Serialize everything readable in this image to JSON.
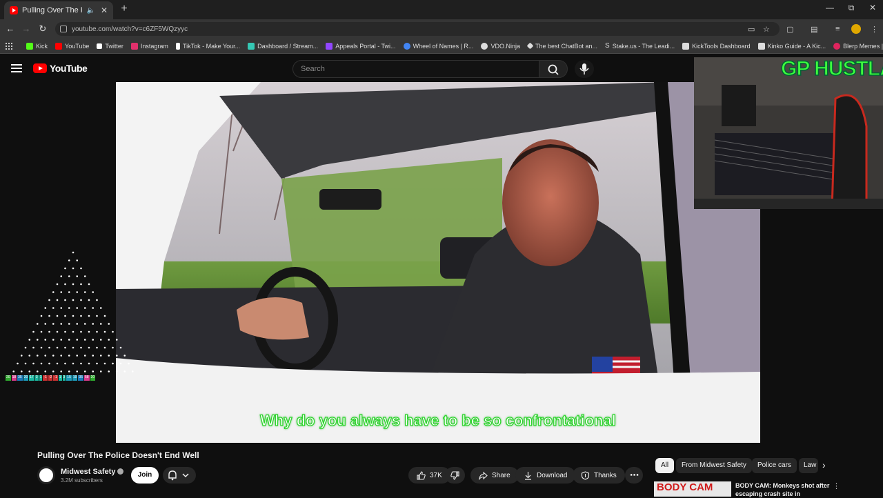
{
  "browser": {
    "tab_title": "Pulling Over The Police Doe",
    "new_tab": "+",
    "url": "youtube.com/watch?v=c6ZF5WQzyyc",
    "bookmarks": [
      {
        "label": "Kick",
        "icon": "kick-icon",
        "color": "#53fc18"
      },
      {
        "label": "YouTube",
        "icon": "youtube-icon",
        "color": "#ff0000"
      },
      {
        "label": "Twitter",
        "icon": "twitter-icon",
        "color": "#ffffff"
      },
      {
        "label": "Instagram",
        "icon": "instagram-icon",
        "color": "#e1306c"
      },
      {
        "label": "TikTok - Make Your...",
        "icon": "tiktok-icon",
        "color": "#ffffff"
      },
      {
        "label": "Dashboard / Stream...",
        "icon": "streamelements-icon",
        "color": "#35c8b4"
      },
      {
        "label": "Appeals Portal - Twi...",
        "icon": "twitch-icon",
        "color": "#9146ff"
      },
      {
        "label": "Wheel of Names | R...",
        "icon": "wheel-icon",
        "color": "#4285f4"
      },
      {
        "label": "VDO.Ninja",
        "icon": "vdo-ninja-icon",
        "color": "#dddddd"
      },
      {
        "label": "The best ChatBot an...",
        "icon": "chatbot-icon",
        "color": "#dddddd"
      },
      {
        "label": "Stake.us - The Leadi...",
        "icon": "stake-icon",
        "color": "#dddddd"
      },
      {
        "label": "KickTools Dashboard",
        "icon": "kicktools-icon",
        "color": "#dddddd"
      },
      {
        "label": "Kinko Guide - A Kic...",
        "icon": "kinko-icon",
        "color": "#dddddd"
      },
      {
        "label": "Blerp Memes | Best...",
        "icon": "blerp-icon",
        "color": "#e0245e"
      }
    ]
  },
  "youtube": {
    "logo_text": "YouTube",
    "search_placeholder": "Search"
  },
  "video": {
    "subtitle": "Why do you always have to be so confrontational",
    "webcam_tag": "GP HUSTLA"
  },
  "overlay_stats": [
    {
      "text": "20",
      "color": "#2ea82e"
    },
    {
      "text": "18",
      "color": "#d63b8a"
    },
    {
      "text": "35",
      "color": "#1c7ab8"
    },
    {
      "text": "20",
      "color": "#1c9ab8"
    },
    {
      "text": "17",
      "color": "#1cb8a0"
    },
    {
      "text": "3",
      "color": "#1cb8a0"
    },
    {
      "text": "1",
      "color": "#1cb8a0"
    },
    {
      "text": "-1",
      "color": "#c93232"
    },
    {
      "text": "-2",
      "color": "#c93232"
    },
    {
      "text": "-1",
      "color": "#c93232"
    },
    {
      "text": "1",
      "color": "#1cb8a0"
    },
    {
      "text": "3",
      "color": "#1cb8a0"
    },
    {
      "text": "15",
      "color": "#1c9ab8"
    },
    {
      "text": "19",
      "color": "#1c9ab8"
    },
    {
      "text": "35",
      "color": "#1c7ab8"
    },
    {
      "text": "58",
      "color": "#d63b8a"
    },
    {
      "text": "20",
      "color": "#2ea82e"
    }
  ],
  "watch": {
    "title": "Pulling Over The Police Doesn't End Well",
    "channel": "Midwest Safety",
    "subscribers": "3.2M subscribers",
    "join_label": "Join",
    "likes": "37K",
    "share_label": "Share",
    "download_label": "Download",
    "thanks_label": "Thanks"
  },
  "chips": [
    "All",
    "From Midwest Safety",
    "Police cars",
    "Law"
  ],
  "recommendation": {
    "thumb_text": "BODY CAM",
    "title": "BODY CAM: Monkeys shot after escaping crash site in"
  }
}
